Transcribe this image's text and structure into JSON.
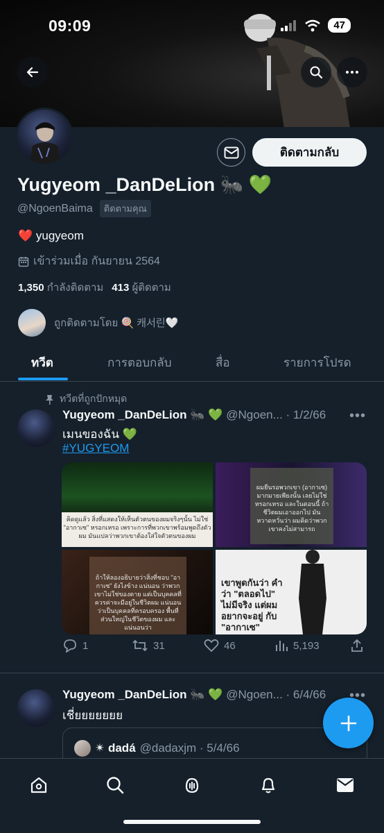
{
  "status_bar": {
    "time": "09:09",
    "battery": "47"
  },
  "profile": {
    "display_name": "Yugyeom _DanDeLion 🐜 💚",
    "handle": "@NgoenBaima",
    "follows_you": "ติดตามคุณ",
    "bio": "❤️ yugyeom",
    "joined": "เข้าร่วมเมื่อ กันยายน 2564",
    "following_count": "1,350",
    "following_label": "กำลังติดตาม",
    "followers_count": "413",
    "followers_label": "ผู้ติดตาม",
    "followed_by": "ถูกติดตามโดย 🍭 캐서린🤍",
    "follow_back_label": "ติดตามกลับ"
  },
  "tabs": [
    "ทวีต",
    "การตอบกลับ",
    "สื่อ",
    "รายการโปรด"
  ],
  "tweets": [
    {
      "pinned_label": "ทวีตที่ถูกปักหมุด",
      "name": "Yugyeom _DanDeLion 🐜 💚",
      "meta": "@Ngoen... · 1/2/66",
      "text": "เมนของฉัน 💚",
      "hashtag": "#YUGYEOM",
      "media_captions": [
        "คิดดูแล้ว สิ่งที่แสดงให้เห็นตัวตนของผมจริงๆนั้น ไม่ใช่ \"อากาเซ\" หรอกเหรอ เพราะการที่พวกเขาพร้อมพูดถึงตัวผม มันแปลว่าพวกเขาต้องใส่ใจตัวตนของผม",
        "ผมยืนรอพวกเขา (อากาเซ) มากมายเพียงนั้น เลยไม่ใช่หรอกเหรอ และในตอนนี้ ถ้าชีวิตผมเอาออกไป มันหวาดหวั่นว่า ผมคิดว่าพวกเขาคงไม่สามารถ",
        "ถ้าให้ลองอธิบายว่าสิ่งที่ชอบ \"อากาเซ\" ยังไงข้าง แน่นอน ว่าพวกเขาไม่ใช่ของตาย แต่เป็นบุคคลที่ควรค่าจะมีอยู่ในชีวิตผม แน่นอนว่าเป็นบุคคลที่ครอบครอง พื้นที่ส่วนใหญ่ในชีวิตของผม และแน่นอนว่า",
        "เขาพูดกันว่า คำว่า \"ตลอดไป\" ไม่มีจริง แต่ผมอยากจะอยู่ กับ \"อากาเซ\""
      ],
      "replies": "1",
      "retweets": "31",
      "likes": "46",
      "views": "5,193"
    },
    {
      "name": "Yugyeom _DanDeLion 🐜 💚",
      "meta": "@Ngoen... · 6/4/66",
      "text": "เชี่ยยยยยยย",
      "quote": {
        "name": "✴ dadá",
        "meta": "@dadaxjm · 5/4/66"
      }
    }
  ],
  "icons": {
    "back": "back-arrow-icon",
    "search": "search-icon",
    "more": "more-icon",
    "message": "envelope-icon",
    "calendar": "calendar-icon",
    "pin": "pin-icon",
    "reply": "reply-icon",
    "retweet": "retweet-icon",
    "like": "heart-icon",
    "views": "views-icon",
    "share": "share-icon",
    "compose": "plus-icon"
  },
  "colors": {
    "background": "#15202b",
    "accent": "#1d9bf0",
    "muted": "#8b98a5",
    "divider": "#38444d"
  }
}
